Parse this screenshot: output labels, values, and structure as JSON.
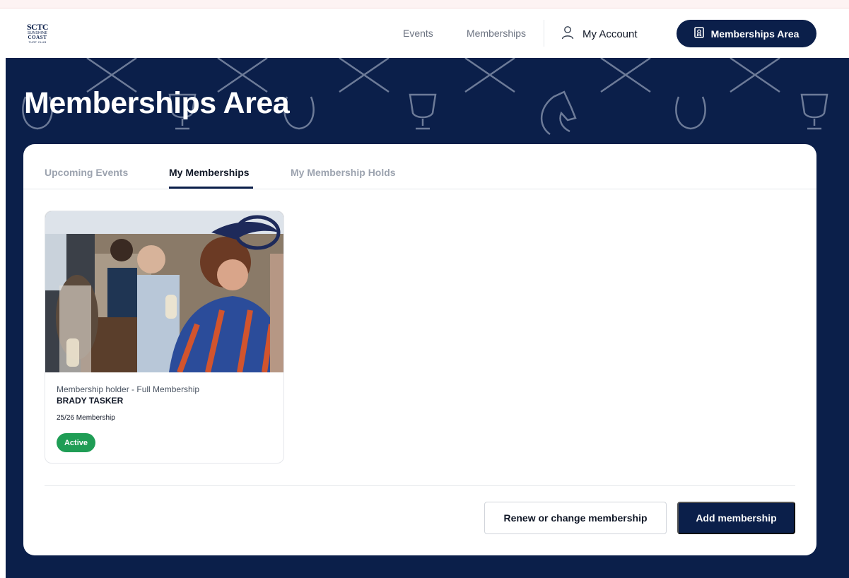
{
  "brand": {
    "logo_main": "SCTC",
    "logo_line1": "SUNSHINE",
    "logo_line2": "COAST",
    "logo_line3": "TURF CLUB"
  },
  "nav": {
    "events": "Events",
    "memberships": "Memberships",
    "account": "My Account",
    "area_button": "Memberships Area",
    "icons": [
      "user-icon",
      "badge-icon"
    ]
  },
  "hero": {
    "title": "Memberships Area"
  },
  "tabs": [
    {
      "label": "Upcoming Events",
      "active": false
    },
    {
      "label": "My Memberships",
      "active": true
    },
    {
      "label": "My Membership Holds",
      "active": false
    }
  ],
  "membership": {
    "holder_label": "Membership holder - Full Membership",
    "name": "BRADY TASKER",
    "season": "25/26 Membership",
    "status": "Active"
  },
  "actions": {
    "renew": "Renew or change membership",
    "add": "Add membership"
  },
  "colors": {
    "navy": "#0b1f4a",
    "active_green": "#1f9d55"
  }
}
